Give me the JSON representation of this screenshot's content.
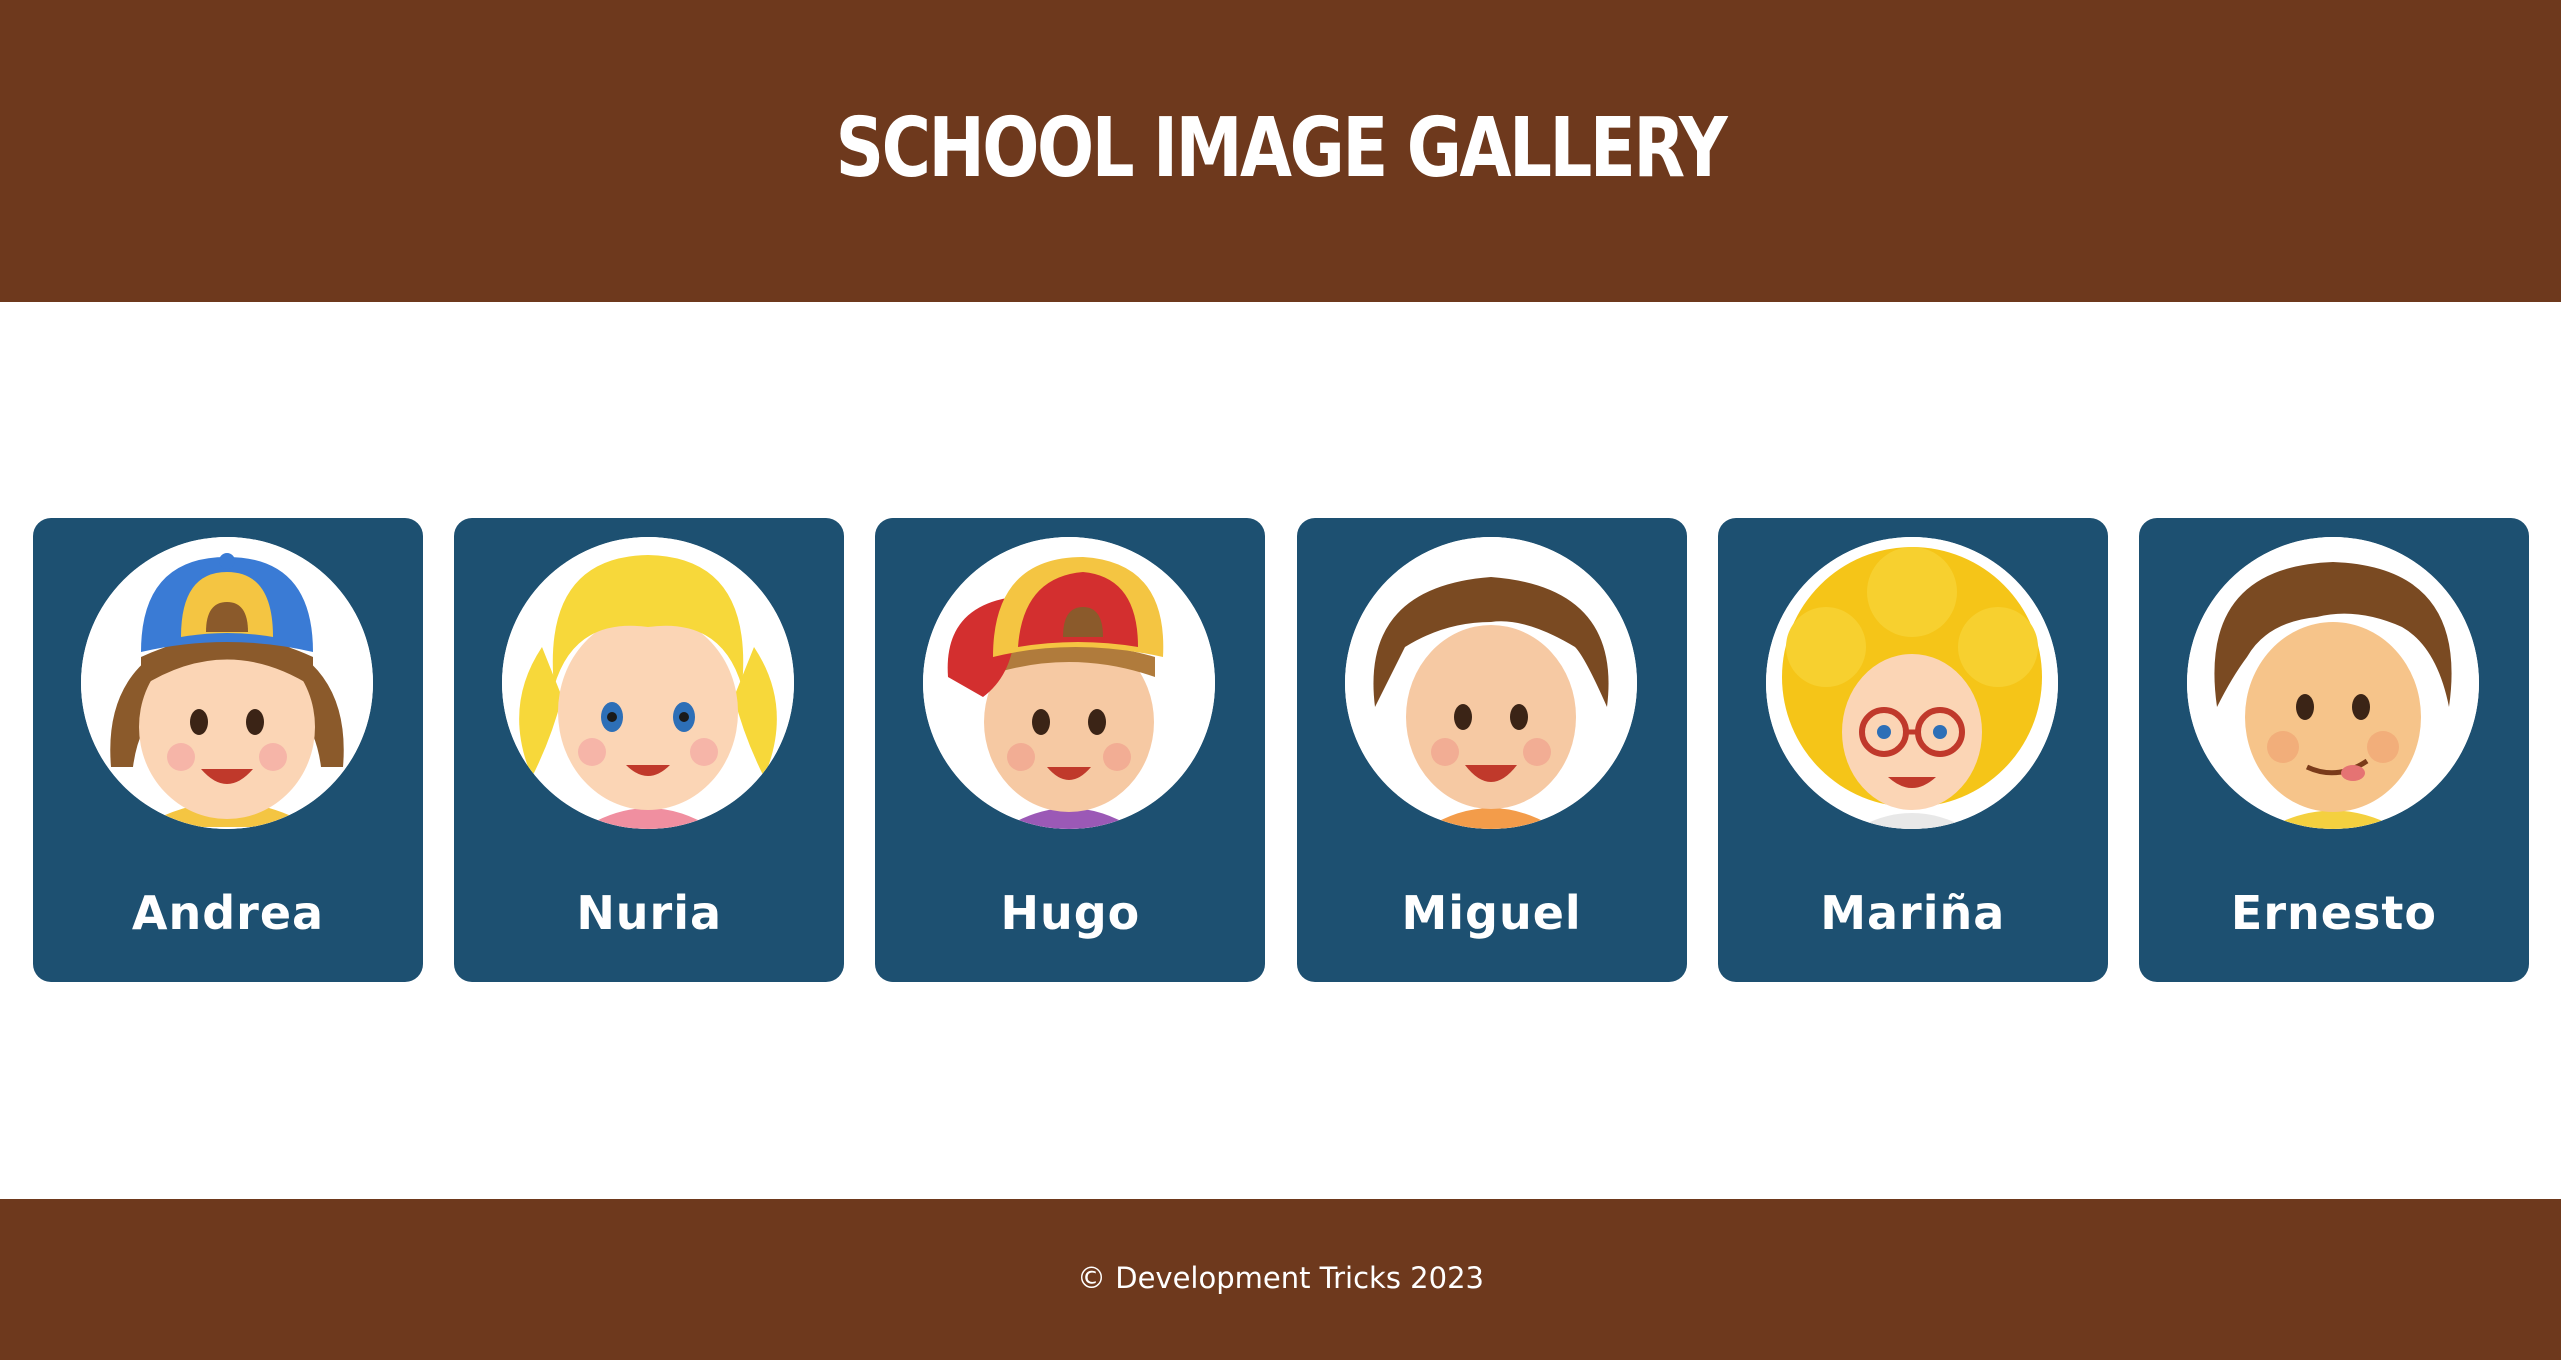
{
  "header": {
    "title": "School Image Gallery"
  },
  "gallery": {
    "students": [
      {
        "name": "Andrea",
        "avatar_icon": "girl-with-blue-cap-icon"
      },
      {
        "name": "Nuria",
        "avatar_icon": "blonde-girl-pigtails-icon"
      },
      {
        "name": "Hugo",
        "avatar_icon": "boy-with-red-cap-icon"
      },
      {
        "name": "Miguel",
        "avatar_icon": "brown-haired-boy-icon"
      },
      {
        "name": "Mariña",
        "avatar_icon": "curly-girl-glasses-icon"
      },
      {
        "name": "Ernesto",
        "avatar_icon": "boy-tongue-out-icon"
      }
    ]
  },
  "footer": {
    "text": "© Development Tricks 2023"
  },
  "colors": {
    "header_bg": "#6e391d",
    "card_bg": "#1d5071",
    "text": "#ffffff"
  }
}
